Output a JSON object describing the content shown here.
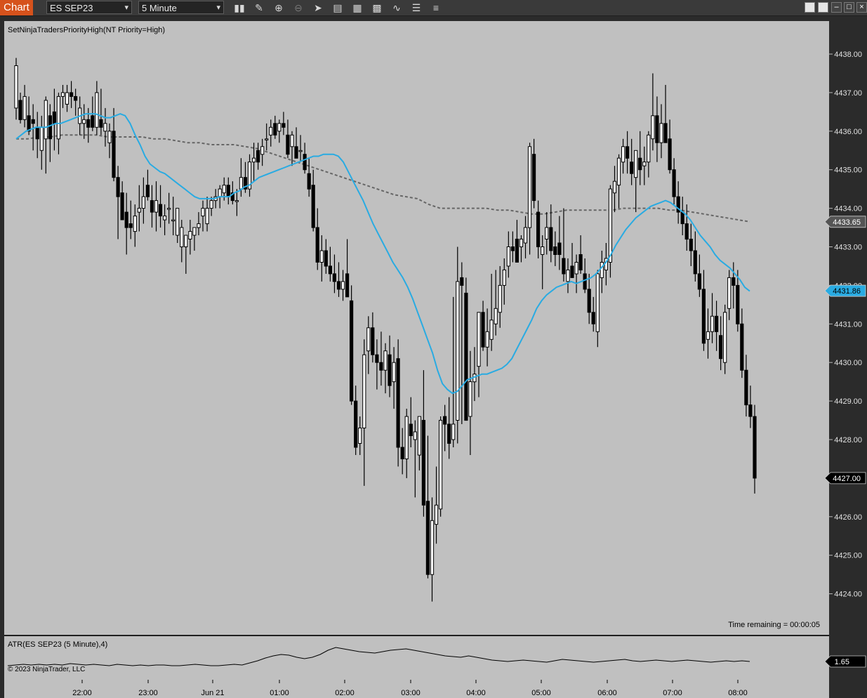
{
  "toolbar": {
    "tab_label": "Chart",
    "instrument": "ES SEP23",
    "interval": "5 Minute",
    "tools": [
      "bar-type-icon",
      "pencil-icon",
      "zoom-in-icon",
      "zoom-out-icon",
      "pointer-icon",
      "data-box-icon",
      "templates-icon",
      "strategies-icon",
      "indicators-icon",
      "properties-icon",
      "list-icon"
    ]
  },
  "colors": {
    "background": "#c0c0c0",
    "up_body": "#ffffff",
    "down_body": "#000000",
    "ema": "#29abe2",
    "sma": "#666666",
    "axis_bg": "#2b2b2b"
  },
  "panel": {
    "indicator_label": "SetNinjaTradersPriorityHigh(NT Priority=High)",
    "time_remaining": "Time remaining = 00:00:05",
    "atr_label": "ATR(ES SEP23 (5 Minute),4)",
    "copyright": "© 2023 NinjaTrader, LLC"
  },
  "chart_data": {
    "type": "candlestick",
    "ylim": [
      4423.2,
      4438.8
    ],
    "y_ticks": [
      "4438.00",
      "4437.00",
      "4436.00",
      "4435.00",
      "4434.00",
      "4433.00",
      "4432.00",
      "4431.00",
      "4430.00",
      "4429.00",
      "4428.00",
      "4427.00",
      "4426.00",
      "4425.00",
      "4424.00"
    ],
    "x_ticks": [
      "22:00",
      "23:00",
      "Jun 21",
      "01:00",
      "02:00",
      "03:00",
      "04:00",
      "05:00",
      "06:00",
      "07:00",
      "08:00"
    ],
    "price_markers": [
      {
        "value": "4433.65",
        "series": "sma",
        "color": "#555555"
      },
      {
        "value": "4431.86",
        "series": "ema",
        "color": "#29abe2"
      },
      {
        "value": "4427.00",
        "series": "last",
        "color": "#000000"
      }
    ],
    "atr_marker": "1.65",
    "candles": [
      [
        4436.6,
        4437.9,
        4436.3,
        4437.7
      ],
      [
        4436.8,
        4437.0,
        4436.2,
        4436.3
      ],
      [
        4436.3,
        4437.2,
        4436.1,
        4436.9
      ],
      [
        4436.4,
        4436.9,
        4435.9,
        4436.0
      ],
      [
        4436.3,
        4436.7,
        4435.5,
        4436.2
      ],
      [
        4436.1,
        4436.5,
        4435.3,
        4435.8
      ],
      [
        4435.5,
        4436.4,
        4435.0,
        4436.1
      ],
      [
        4435.8,
        4436.9,
        4434.9,
        4436.8
      ],
      [
        4436.4,
        4436.7,
        4435.2,
        4435.8
      ],
      [
        4436.5,
        4437.1,
        4435.5,
        4436.2
      ],
      [
        4435.8,
        4437.0,
        4435.4,
        4436.9
      ],
      [
        4436.9,
        4437.2,
        4436.6,
        4437.0
      ],
      [
        4436.7,
        4437.2,
        4436.5,
        4437.0
      ],
      [
        4437.0,
        4437.3,
        4436.6,
        4436.9
      ],
      [
        4436.9,
        4437.1,
        4436.4,
        4436.8
      ],
      [
        4436.2,
        4436.9,
        4435.9,
        4436.6
      ],
      [
        4436.2,
        4436.7,
        4435.8,
        4436.3
      ],
      [
        4436.3,
        4436.6,
        4435.7,
        4436.1
      ],
      [
        4436.4,
        4436.9,
        4436.0,
        4436.1
      ],
      [
        4436.1,
        4437.3,
        4435.9,
        4437.0
      ],
      [
        4436.3,
        4437.1,
        4435.9,
        4436.1
      ],
      [
        4436.0,
        4436.6,
        4435.6,
        4436.2
      ],
      [
        4435.7,
        4436.2,
        4435.3,
        4436.0
      ],
      [
        4436.0,
        4436.6,
        4434.7,
        4434.8
      ],
      [
        4434.8,
        4435.1,
        4433.2,
        4434.3
      ],
      [
        4434.4,
        4434.7,
        4433.7,
        4433.7
      ],
      [
        4433.9,
        4434.4,
        4432.8,
        4433.5
      ],
      [
        4433.6,
        4434.2,
        4433.2,
        4433.5
      ],
      [
        4433.4,
        4434.1,
        4433.0,
        4433.8
      ],
      [
        4433.9,
        4434.6,
        4433.4,
        4434.0
      ],
      [
        4434.0,
        4434.8,
        4433.6,
        4434.3
      ],
      [
        4434.6,
        4435.0,
        4434.2,
        4434.3
      ],
      [
        4434.2,
        4434.6,
        4433.5,
        4433.9
      ],
      [
        4433.9,
        4434.7,
        4433.4,
        4434.2
      ],
      [
        4434.1,
        4434.6,
        4433.5,
        4433.8
      ],
      [
        4433.7,
        4434.1,
        4433.3,
        4433.8
      ],
      [
        4434.0,
        4434.4,
        4433.6,
        4434.0
      ],
      [
        4433.7,
        4434.3,
        4433.3,
        4433.7
      ],
      [
        4433.3,
        4434.0,
        4433.1,
        4434.0
      ],
      [
        4433.0,
        4433.7,
        4432.6,
        4433.5
      ],
      [
        4433.0,
        4433.2,
        4432.3,
        4433.3
      ],
      [
        4433.2,
        4433.7,
        4432.8,
        4433.4
      ],
      [
        4433.3,
        4433.5,
        4432.9,
        4433.5
      ],
      [
        4433.5,
        4433.9,
        4433.3,
        4433.6
      ],
      [
        4433.8,
        4434.2,
        4433.4,
        4434.0
      ],
      [
        4433.6,
        4434.3,
        4433.4,
        4434.0
      ],
      [
        4434.0,
        4434.3,
        4433.8,
        4434.2
      ],
      [
        4434.2,
        4434.5,
        4434.0,
        4434.3
      ],
      [
        4434.3,
        4434.6,
        4434.0,
        4434.5
      ],
      [
        4434.4,
        4434.8,
        4434.2,
        4434.6
      ],
      [
        4434.6,
        4434.8,
        4434.1,
        4434.3
      ],
      [
        4434.4,
        4434.7,
        4434.1,
        4434.2
      ],
      [
        4434.2,
        4434.5,
        4433.8,
        4434.2
      ],
      [
        4434.5,
        4435.3,
        4434.3,
        4434.8
      ],
      [
        4434.8,
        4435.2,
        4434.4,
        4434.5
      ],
      [
        4434.5,
        4435.4,
        4434.3,
        4435.2
      ],
      [
        4435.2,
        4435.7,
        4434.7,
        4435.3
      ],
      [
        4435.5,
        4435.7,
        4435.0,
        4435.2
      ],
      [
        4435.4,
        4435.8,
        4435.1,
        4435.6
      ],
      [
        4435.8,
        4436.2,
        4435.5,
        4435.8
      ],
      [
        4435.9,
        4436.3,
        4435.6,
        4436.1
      ],
      [
        4436.2,
        4436.4,
        4435.8,
        4435.9
      ],
      [
        4436.0,
        4436.3,
        4435.7,
        4436.2
      ],
      [
        4436.2,
        4436.5,
        4435.9,
        4436.1
      ],
      [
        4435.9,
        4436.3,
        4435.3,
        4435.4
      ],
      [
        4435.6,
        4436.0,
        4435.1,
        4435.9
      ],
      [
        4435.6,
        4436.1,
        4435.3,
        4435.3
      ],
      [
        4435.5,
        4435.9,
        4435.2,
        4435.5
      ],
      [
        4435.4,
        4435.7,
        4434.9,
        4435.0
      ],
      [
        4434.9,
        4435.3,
        4434.3,
        4434.5
      ],
      [
        4434.6,
        4435.0,
        4433.4,
        4433.5
      ],
      [
        4433.5,
        4434.0,
        4432.4,
        4432.6
      ],
      [
        4432.6,
        4433.3,
        4432.1,
        4432.9
      ],
      [
        4432.9,
        4433.2,
        4432.3,
        4432.5
      ],
      [
        4432.5,
        4433.0,
        4432.1,
        4432.3
      ],
      [
        4432.3,
        4432.8,
        4431.8,
        4432.1
      ],
      [
        4432.1,
        4432.6,
        4431.7,
        4431.9
      ],
      [
        4431.9,
        4432.4,
        4431.6,
        4432.1
      ],
      [
        4432.3,
        4433.2,
        4431.8,
        4431.7
      ],
      [
        4431.6,
        4432.0,
        4428.9,
        4429.0
      ],
      [
        4429.0,
        4429.4,
        4427.6,
        4427.8
      ],
      [
        4427.9,
        4428.6,
        4427.6,
        4428.3
      ],
      [
        4428.3,
        4430.6,
        4426.8,
        4430.2
      ],
      [
        4430.3,
        4431.2,
        4429.7,
        4430.9
      ],
      [
        4430.9,
        4431.3,
        4430.0,
        4430.2
      ],
      [
        4430.2,
        4430.6,
        4429.3,
        4430.0
      ],
      [
        4430.0,
        4430.8,
        4429.4,
        4429.8
      ],
      [
        4429.8,
        4430.5,
        4429.2,
        4430.3
      ],
      [
        4430.2,
        4430.7,
        4429.1,
        4429.4
      ],
      [
        4429.5,
        4430.4,
        4428.8,
        4430.0
      ],
      [
        4430.1,
        4430.6,
        4427.3,
        4427.8
      ],
      [
        4427.8,
        4428.3,
        4427.1,
        4427.5
      ],
      [
        4427.5,
        4428.8,
        4427.0,
        4428.6
      ],
      [
        4428.4,
        4429.1,
        4427.8,
        4428.1
      ],
      [
        4428.0,
        4428.5,
        4426.5,
        4428.2
      ],
      [
        4427.6,
        4428.6,
        4427.2,
        4428.6
      ],
      [
        4428.5,
        4429.8,
        4426.0,
        4426.3
      ],
      [
        4426.4,
        4428.1,
        4424.4,
        4424.5
      ],
      [
        4424.5,
        4426.5,
        4423.8,
        4425.9
      ],
      [
        4425.8,
        4427.3,
        4425.3,
        4426.3
      ],
      [
        4426.2,
        4428.6,
        4426.0,
        4428.5
      ],
      [
        4428.6,
        4428.9,
        4427.7,
        4428.4
      ],
      [
        4428.4,
        4429.1,
        4427.5,
        4427.9
      ],
      [
        4428.0,
        4431.7,
        4427.8,
        4428.4
      ],
      [
        4428.5,
        4433.0,
        4427.9,
        4432.1
      ],
      [
        4432.2,
        4432.6,
        4428.4,
        4432.0
      ],
      [
        4431.8,
        4432.2,
        4428.5,
        4428.5
      ],
      [
        4428.6,
        4430.3,
        4427.6,
        4429.5
      ],
      [
        4429.5,
        4430.4,
        4429.0,
        4429.7
      ],
      [
        4429.9,
        4431.2,
        4429.1,
        4431.3
      ],
      [
        4431.3,
        4431.6,
        4430.3,
        4430.4
      ],
      [
        4430.4,
        4431.4,
        4429.9,
        4430.8
      ],
      [
        4430.6,
        4432.3,
        4430.3,
        4431.1
      ],
      [
        4431.0,
        4432.4,
        4430.7,
        4431.4
      ],
      [
        4431.3,
        4432.5,
        4430.9,
        4432.0
      ],
      [
        4432.0,
        4432.7,
        4431.5,
        4432.4
      ],
      [
        4432.5,
        4433.4,
        4432.2,
        4433.0
      ],
      [
        4433.0,
        4433.4,
        4432.6,
        4432.9
      ],
      [
        4433.2,
        4433.7,
        4432.9,
        4432.6
      ],
      [
        4433.0,
        4433.3,
        4432.6,
        4433.2
      ],
      [
        4433.1,
        4433.8,
        4432.7,
        4433.5
      ],
      [
        4433.5,
        4435.7,
        4432.8,
        4435.6
      ],
      [
        4435.4,
        4435.8,
        4434.0,
        4434.2
      ],
      [
        4433.9,
        4434.2,
        4432.7,
        4433.0
      ],
      [
        4432.8,
        4433.3,
        4431.9,
        4433.0
      ],
      [
        4433.2,
        4433.9,
        4432.8,
        4433.5
      ],
      [
        4433.5,
        4434.1,
        4432.6,
        4432.9
      ],
      [
        4433.0,
        4433.4,
        4432.5,
        4432.8
      ],
      [
        4433.1,
        4433.8,
        4432.4,
        4432.8
      ],
      [
        4432.7,
        4434.0,
        4432.1,
        4432.3
      ],
      [
        4432.1,
        4432.7,
        4431.8,
        4432.4
      ],
      [
        4432.5,
        4433.1,
        4432.2,
        4432.2
      ],
      [
        4432.3,
        4432.8,
        4431.8,
        4432.6
      ],
      [
        4432.8,
        4433.3,
        4432.3,
        4432.4
      ],
      [
        4432.3,
        4432.7,
        4431.8,
        4431.9
      ],
      [
        4431.9,
        4432.3,
        4431.0,
        4431.3
      ],
      [
        4431.3,
        4431.7,
        4430.8,
        4431.0
      ],
      [
        4430.8,
        4432.4,
        4430.4,
        4432.3
      ],
      [
        4432.2,
        4432.9,
        4431.8,
        4432.6
      ],
      [
        4432.4,
        4433.1,
        4432.0,
        4432.7
      ],
      [
        4432.6,
        4434.6,
        4432.2,
        4434.5
      ],
      [
        4434.4,
        4435.1,
        4433.9,
        4434.7
      ],
      [
        4434.6,
        4435.4,
        4434.0,
        4435.3
      ],
      [
        4435.2,
        4435.8,
        4434.9,
        4435.6
      ],
      [
        4435.6,
        4436.0,
        4434.9,
        4435.3
      ],
      [
        4435.2,
        4435.8,
        4434.6,
        4434.9
      ],
      [
        4434.8,
        4435.4,
        4433.9,
        4435.5
      ],
      [
        4435.3,
        4436.0,
        4434.6,
        4435.0
      ],
      [
        4435.1,
        4435.6,
        4434.6,
        4435.2
      ],
      [
        4435.2,
        4436.0,
        4434.8,
        4435.9
      ],
      [
        4435.8,
        4437.5,
        4435.5,
        4436.4
      ],
      [
        4436.4,
        4436.9,
        4435.2,
        4435.7
      ],
      [
        4435.7,
        4436.7,
        4435.3,
        4436.2
      ],
      [
        4436.2,
        4437.2,
        4435.7,
        4435.7
      ],
      [
        4435.8,
        4436.3,
        4434.9,
        4435.0
      ],
      [
        4435.0,
        4435.3,
        4434.1,
        4434.3
      ],
      [
        4434.3,
        4434.7,
        4433.6,
        4433.9
      ],
      [
        4433.9,
        4434.3,
        4433.3,
        4433.6
      ],
      [
        4433.6,
        4434.1,
        4432.9,
        4433.2
      ],
      [
        4433.2,
        4433.6,
        4432.5,
        4432.9
      ],
      [
        4432.9,
        4433.4,
        4432.1,
        4432.3
      ],
      [
        4432.3,
        4432.8,
        4431.7,
        4431.9
      ],
      [
        4431.9,
        4432.4,
        4430.3,
        4430.5
      ],
      [
        4430.6,
        4431.4,
        4430.1,
        4430.8
      ],
      [
        4430.8,
        4431.8,
        4430.5,
        4431.2
      ],
      [
        4431.2,
        4431.6,
        4430.3,
        4430.8
      ],
      [
        4430.7,
        4431.2,
        4429.8,
        4430.1
      ],
      [
        4430.0,
        4431.5,
        4429.7,
        4431.3
      ],
      [
        4431.4,
        4432.4,
        4431.1,
        4432.2
      ],
      [
        4432.2,
        4432.6,
        4431.4,
        4432.0
      ],
      [
        4432.0,
        4432.4,
        4430.8,
        4431.0
      ],
      [
        4431.0,
        4431.4,
        4429.6,
        4429.8
      ],
      [
        4429.8,
        4430.2,
        4428.6,
        4428.9
      ],
      [
        4428.9,
        4429.4,
        4428.3,
        4428.6
      ],
      [
        4428.6,
        4428.9,
        4426.6,
        4427.0
      ]
    ],
    "ema_series": [
      4435.8,
      4435.9,
      4436.0,
      4436.05,
      4436.1,
      4436.1,
      4436.1,
      4436.15,
      4436.2,
      4436.2,
      4436.25,
      4436.3,
      4436.35,
      4436.4,
      4436.45,
      4436.45,
      4436.45,
      4436.4,
      4436.35,
      4436.35,
      4436.4,
      4436.45,
      4436.4,
      4436.2,
      4435.9,
      4435.65,
      4435.35,
      4435.15,
      4435.05,
      4434.95,
      4434.9,
      4434.8,
      4434.7,
      4434.6,
      4434.5,
      4434.4,
      4434.3,
      4434.25,
      4434.25,
      4434.25,
      4434.25,
      4434.3,
      4434.3,
      4434.3,
      4434.4,
      4434.45,
      4434.55,
      4434.6,
      4434.7,
      4434.8,
      4434.85,
      4434.9,
      4434.95,
      4435.0,
      4435.05,
      4435.1,
      4435.15,
      4435.2,
      4435.25,
      4435.3,
      4435.35,
      4435.35,
      4435.4,
      4435.4,
      4435.4,
      4435.35,
      4435.2,
      4434.95,
      4434.7,
      4434.45,
      4434.2,
      4433.9,
      4433.6,
      4433.35,
      4433.1,
      4432.85,
      4432.6,
      4432.4,
      4432.2,
      4431.95,
      4431.65,
      4431.3,
      4430.95,
      4430.6,
      4430.25,
      4429.8,
      4429.45,
      4429.3,
      4429.2,
      4429.25,
      4429.4,
      4429.55,
      4429.6,
      4429.65,
      4429.7,
      4429.7,
      4429.75,
      4429.8,
      4429.85,
      4429.95,
      4430.1,
      4430.35,
      4430.6,
      4430.85,
      4431.1,
      4431.4,
      4431.6,
      4431.75,
      4431.85,
      4431.95,
      4432.0,
      4432.05,
      4432.1,
      4432.05,
      4432.1,
      4432.15,
      4432.2,
      4432.3,
      4432.45,
      4432.6,
      4432.8,
      4433.05,
      4433.25,
      4433.45,
      4433.6,
      4433.75,
      4433.85,
      4433.95,
      4434.05,
      4434.1,
      4434.15,
      4434.2,
      4434.15,
      4434.05,
      4433.95,
      4433.85,
      4433.7,
      4433.5,
      4433.3,
      4433.15,
      4433.0,
      4432.8,
      4432.65,
      4432.55,
      4432.45,
      4432.3,
      4432.15,
      4431.95,
      4431.85
    ],
    "sma_series": [
      4435.8,
      4435.8,
      4435.85,
      4435.85,
      4435.9,
      4435.9,
      4435.9,
      4435.9,
      4435.85,
      4435.85,
      4435.85,
      4435.85,
      4435.8,
      4435.8,
      4435.75,
      4435.7,
      4435.7,
      4435.65,
      4435.65,
      4435.65,
      4435.6,
      4435.55,
      4435.45,
      4435.35,
      4435.25,
      4435.15,
      4435.05,
      4434.95,
      4434.85,
      4434.75,
      4434.65,
      4434.55,
      4434.45,
      4434.35,
      4434.3,
      4434.25,
      4434.1,
      4434.0,
      4434.0,
      4434.0,
      4434.0,
      4434.0,
      4433.95,
      4433.95,
      4433.9,
      4433.85,
      4433.85,
      4433.9,
      4433.95,
      4433.95,
      4433.95,
      4433.95,
      4433.95,
      4434.0,
      4434.0,
      4434.0,
      4434.0,
      4433.95,
      4433.95,
      4433.9,
      4433.85,
      4433.8,
      4433.75,
      4433.7,
      4433.65
    ]
  }
}
